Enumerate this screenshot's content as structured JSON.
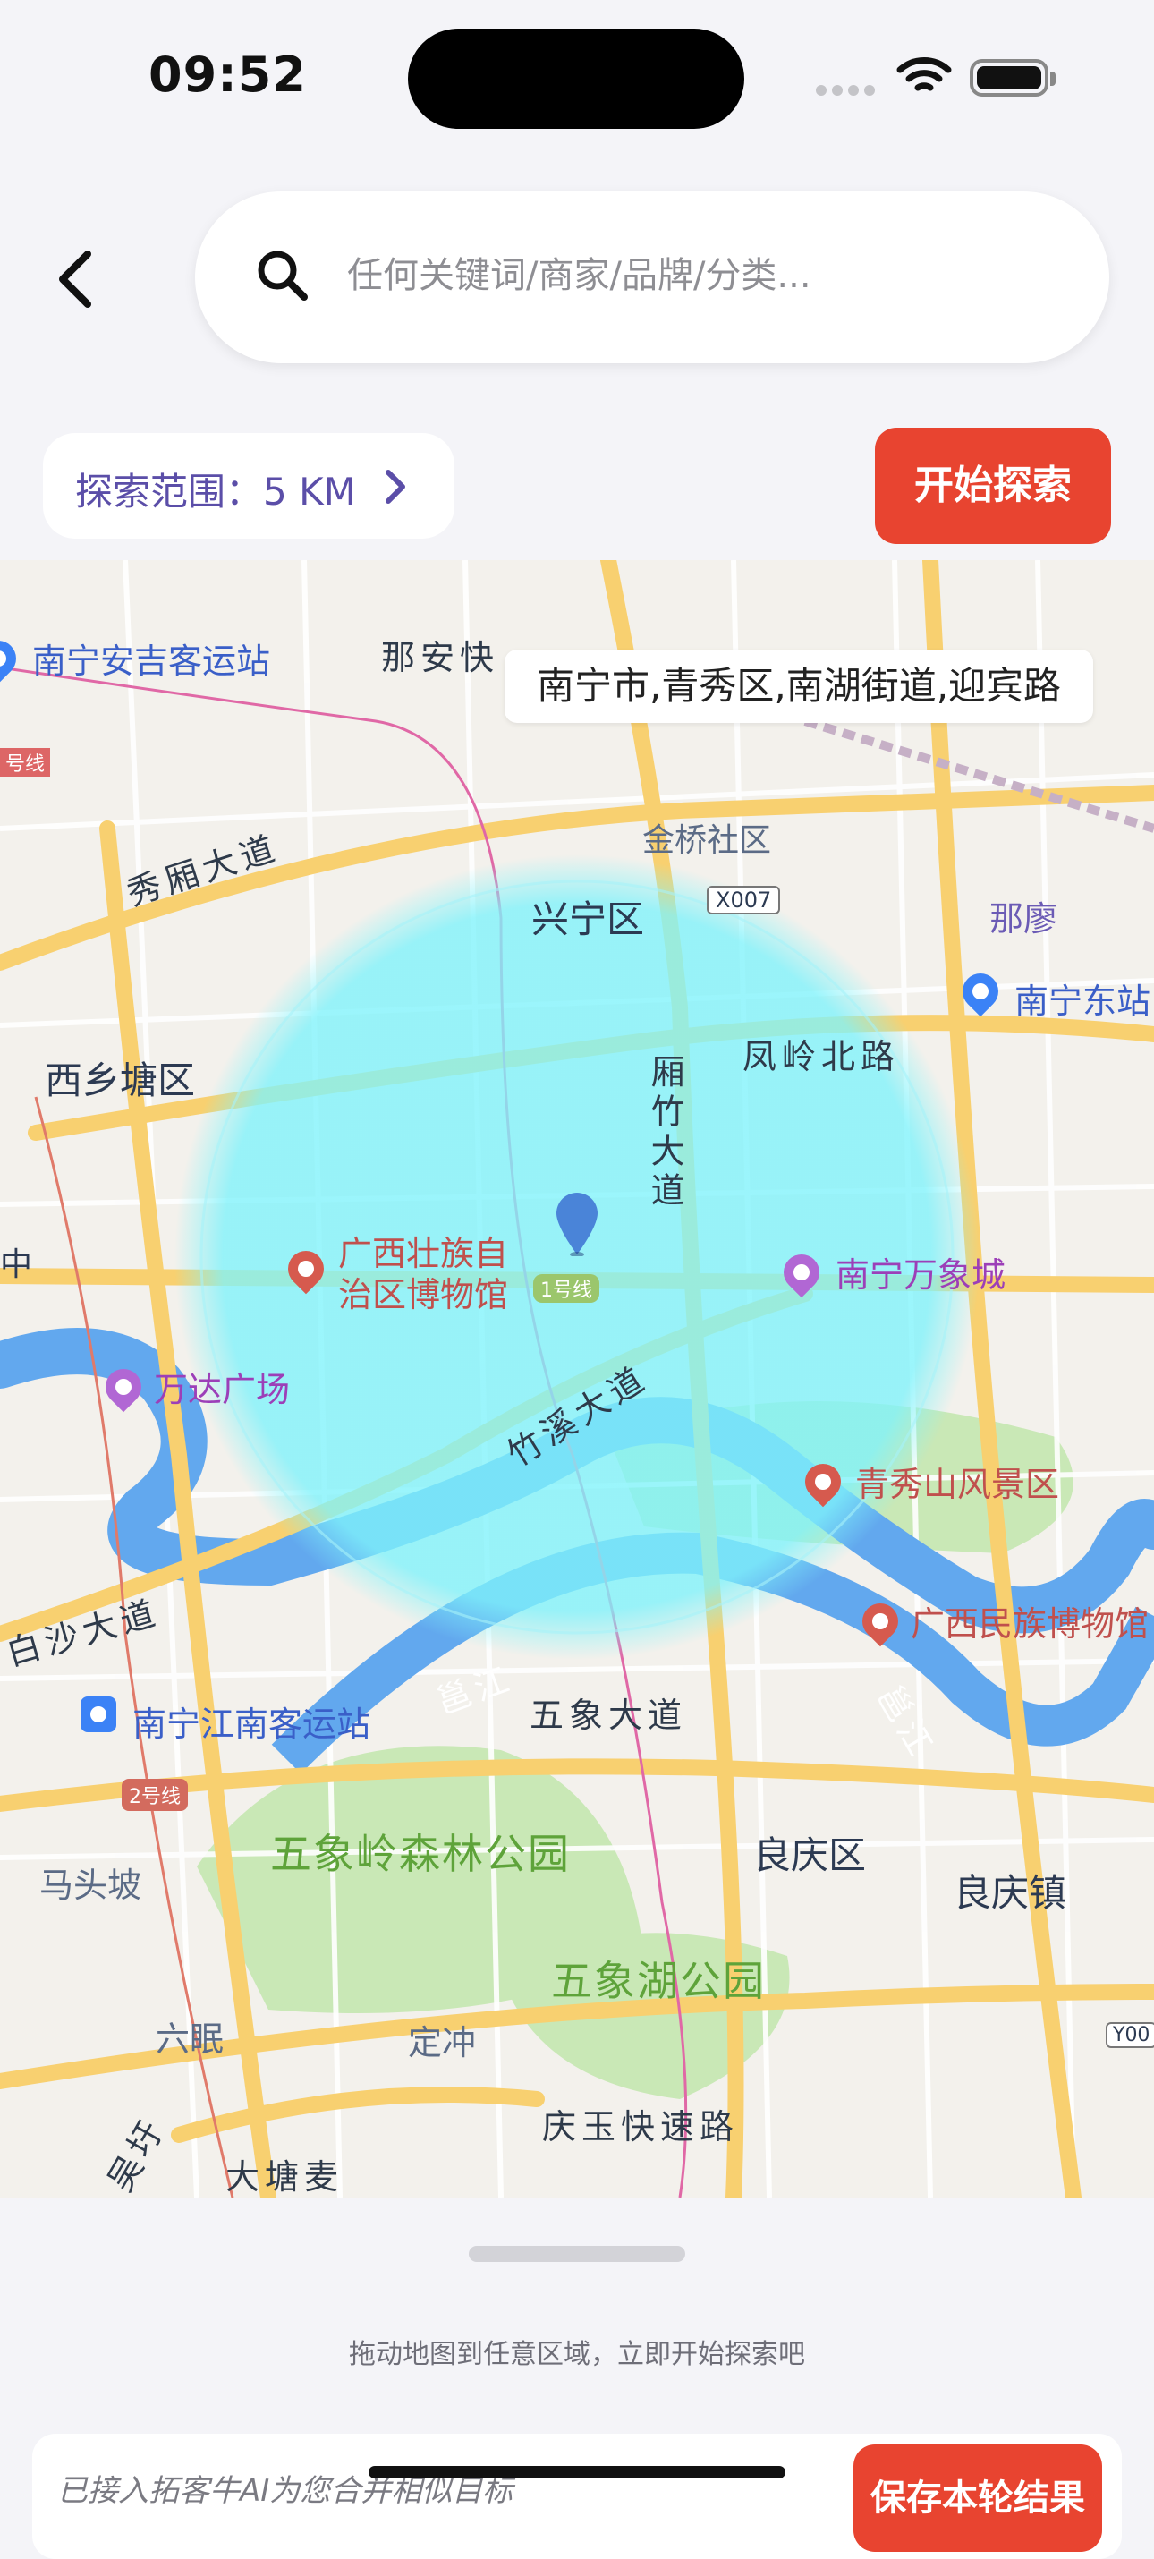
{
  "status_bar": {
    "time": "09:52"
  },
  "search": {
    "placeholder": "任何关键词/商家/品牌/分类..."
  },
  "range": {
    "label": "探索范围：5 KM"
  },
  "start_button": {
    "label": "开始探索"
  },
  "map": {
    "address": "南宁市,青秀区,南湖街道,迎宾路",
    "districts": {
      "xingning": "兴宁区",
      "xixiangtang": "西乡塘区",
      "liangqing": "良庆区",
      "jinqiao": "金桥社区",
      "naliao": "那廖",
      "liangqingzhen": "良庆镇",
      "matoupo": "马头坡",
      "liumian": "六眠",
      "dingchong": "定冲"
    },
    "roads": {
      "xiuxiang": "秀厢大道",
      "fengling": "凤岭北路",
      "yongzhu": "厢竹大道",
      "zhuxi": "竹溪大道",
      "baisha": "白沙大道",
      "wuxiang": "五象大道",
      "naan": "那安快",
      "qingyu": "庆玉快速路",
      "yongjiang_1": "邕江",
      "yongjiang_2": "邕江",
      "metro_1": "1号线",
      "metro_2": "2号线",
      "x007": "X007",
      "y00": "Y00",
      "edge_line": "号线",
      "edge_zhong": "中",
      "bottom_edge": "大塘麦",
      "bottom_left": "吴圩"
    },
    "pois": {
      "anji": "南宁安吉客运站",
      "dongzhan": "南宁东站",
      "museum_gx": "广西壮族自\n治区博物馆",
      "wanxiang": "南宁万象城",
      "wanda": "万达广场",
      "qingxiu": "青秀山风景区",
      "minzu": "广西民族博物馆",
      "jiangnan": "南宁江南客运站"
    },
    "parks": {
      "wuxiangling": "五象岭森林公园",
      "wuxianghu": "五象湖公园"
    },
    "colors": {
      "radius_fill": "#7ff3fb",
      "pin": "#4a84d8",
      "river": "#62a8ee",
      "major_road": "#f8d070",
      "park": "#c9e8b6"
    }
  },
  "sheet": {
    "hint": "拖动地图到任意区域，立即开始探索吧",
    "card_text": "已接入拓客牛AI为您合并相似目标",
    "save_button": "保存本轮结果"
  },
  "icons": {
    "back": "chevron-left-icon",
    "search": "search-icon",
    "range": "chevron-right-icon",
    "location": "location-pin-icon"
  }
}
